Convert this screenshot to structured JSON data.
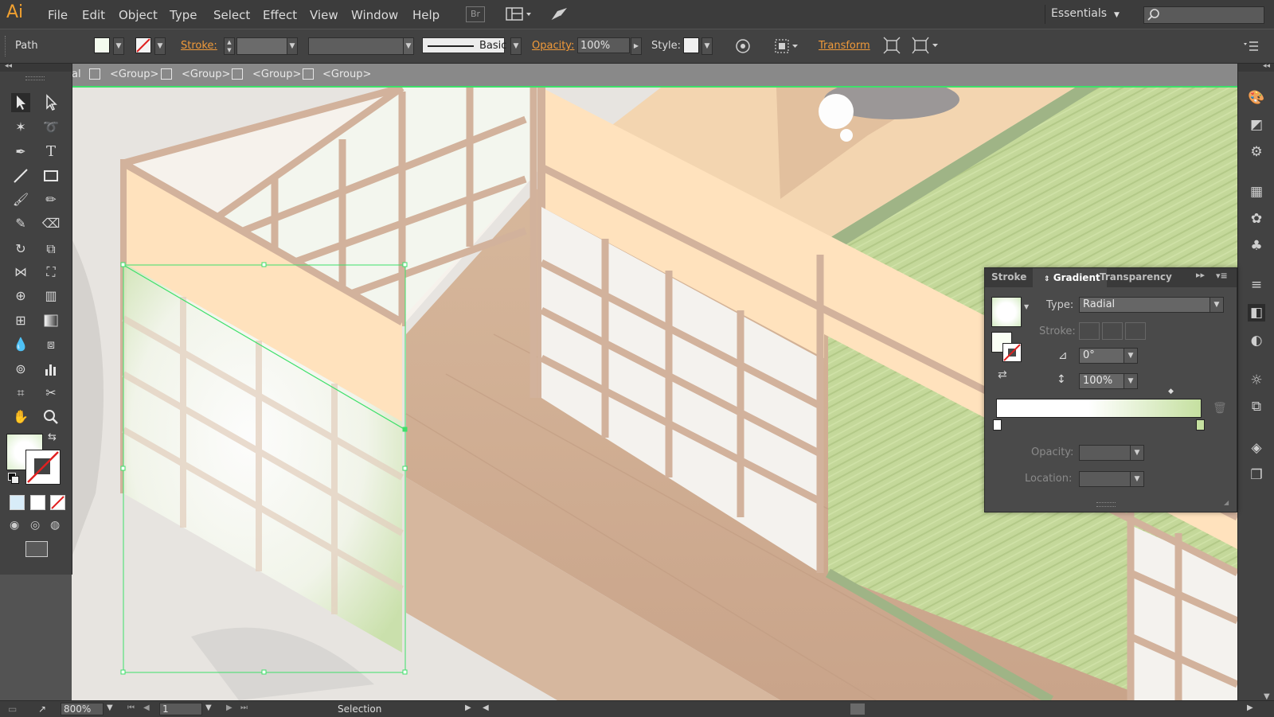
{
  "app": {
    "logo": "Ai"
  },
  "menu": [
    "File",
    "Edit",
    "Object",
    "Type",
    "Select",
    "Effect",
    "View",
    "Window",
    "Help"
  ],
  "menu_icons": {
    "bridge": "Br"
  },
  "workspace": {
    "label": "Essentials"
  },
  "control_bar": {
    "selection_type": "Path",
    "stroke_label": "Stroke:",
    "brush_label": "Basic",
    "opacity_label": "Opacity:",
    "opacity_value": "100%",
    "style_label": "Style:",
    "transform_label": "Transform"
  },
  "breadcrumb": [
    "al",
    "<Group>",
    "<Group>",
    "<Group>",
    "<Group>"
  ],
  "gradient_panel": {
    "tabs": [
      "Stroke",
      "Gradient",
      "Transparency"
    ],
    "type_label": "Type:",
    "type_value": "Radial",
    "stroke_label": "Stroke:",
    "angle_value": "0°",
    "aspect_value": "100%",
    "opacity_label": "Opacity:",
    "location_label": "Location:",
    "gradient_start_color": "#ffffff",
    "gradient_end_color": "#c5e0a0"
  },
  "status_bar": {
    "zoom": "800%",
    "artboard": "1",
    "tool": "Selection"
  },
  "colors": {
    "selection_accent": "#3ee06a",
    "ui_dark": "#424242",
    "link_orange": "#f09a3a"
  }
}
